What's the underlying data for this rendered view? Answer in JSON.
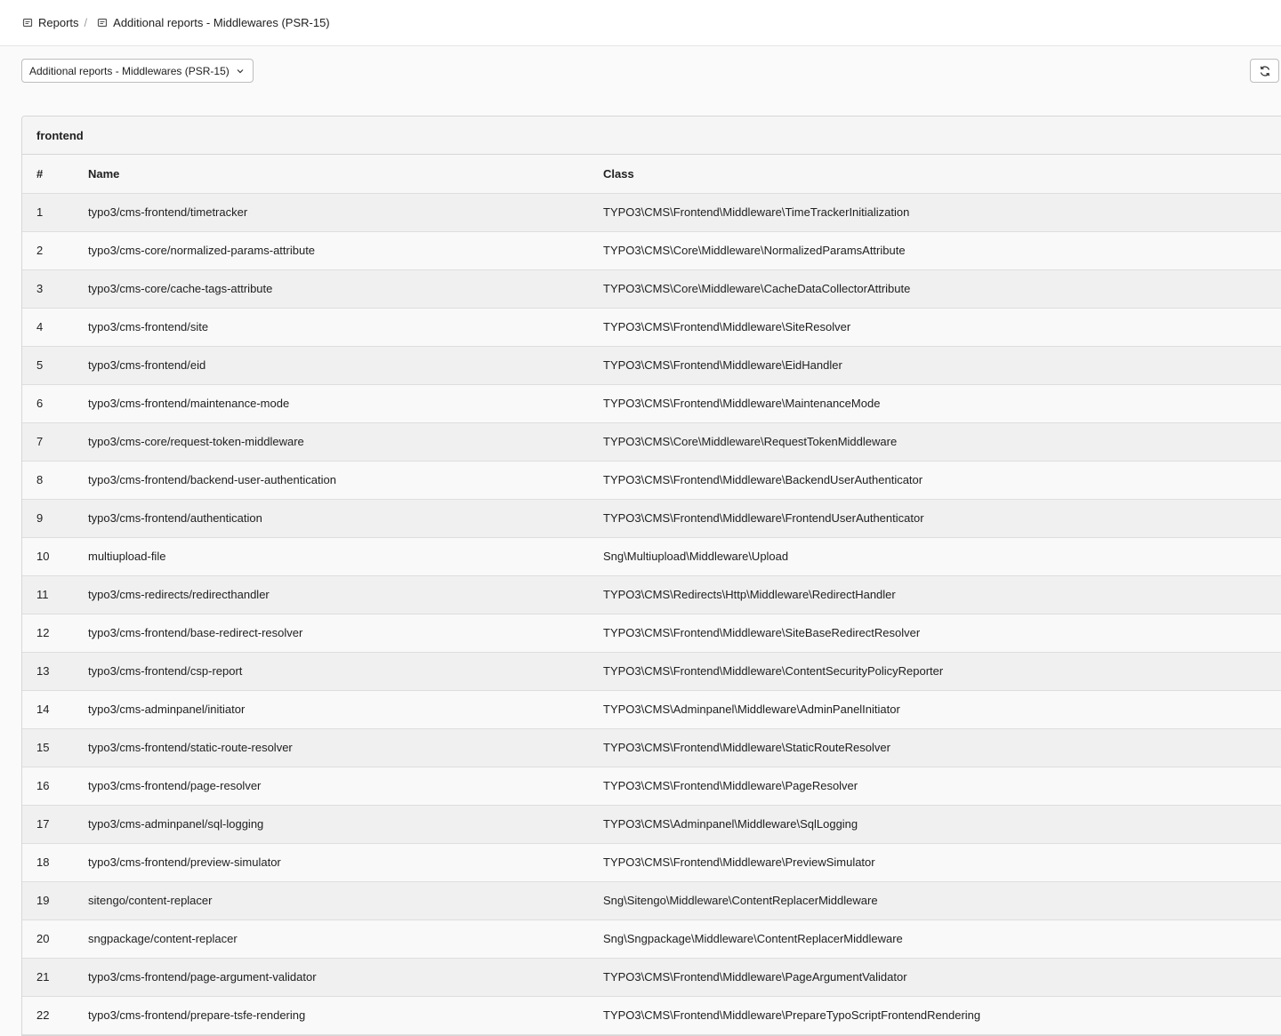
{
  "breadcrumb": {
    "root": "Reports",
    "separator": "/",
    "current": "Additional reports - Middlewares (PSR-15)"
  },
  "toolbar": {
    "report_select_value": "Additional reports - Middlewares (PSR-15)"
  },
  "panel": {
    "title": "frontend",
    "columns": [
      "#",
      "Name",
      "Class"
    ],
    "rows": [
      {
        "n": "1",
        "name": "typo3/cms-frontend/timetracker",
        "cls": "TYPO3\\CMS\\Frontend\\Middleware\\TimeTrackerInitialization"
      },
      {
        "n": "2",
        "name": "typo3/cms-core/normalized-params-attribute",
        "cls": "TYPO3\\CMS\\Core\\Middleware\\NormalizedParamsAttribute"
      },
      {
        "n": "3",
        "name": "typo3/cms-core/cache-tags-attribute",
        "cls": "TYPO3\\CMS\\Core\\Middleware\\CacheDataCollectorAttribute"
      },
      {
        "n": "4",
        "name": "typo3/cms-frontend/site",
        "cls": "TYPO3\\CMS\\Frontend\\Middleware\\SiteResolver"
      },
      {
        "n": "5",
        "name": "typo3/cms-frontend/eid",
        "cls": "TYPO3\\CMS\\Frontend\\Middleware\\EidHandler"
      },
      {
        "n": "6",
        "name": "typo3/cms-frontend/maintenance-mode",
        "cls": "TYPO3\\CMS\\Frontend\\Middleware\\MaintenanceMode"
      },
      {
        "n": "7",
        "name": "typo3/cms-core/request-token-middleware",
        "cls": "TYPO3\\CMS\\Core\\Middleware\\RequestTokenMiddleware"
      },
      {
        "n": "8",
        "name": "typo3/cms-frontend/backend-user-authentication",
        "cls": "TYPO3\\CMS\\Frontend\\Middleware\\BackendUserAuthenticator"
      },
      {
        "n": "9",
        "name": "typo3/cms-frontend/authentication",
        "cls": "TYPO3\\CMS\\Frontend\\Middleware\\FrontendUserAuthenticator"
      },
      {
        "n": "10",
        "name": "multiupload-file",
        "cls": "Sng\\Multiupload\\Middleware\\Upload"
      },
      {
        "n": "11",
        "name": "typo3/cms-redirects/redirecthandler",
        "cls": "TYPO3\\CMS\\Redirects\\Http\\Middleware\\RedirectHandler"
      },
      {
        "n": "12",
        "name": "typo3/cms-frontend/base-redirect-resolver",
        "cls": "TYPO3\\CMS\\Frontend\\Middleware\\SiteBaseRedirectResolver"
      },
      {
        "n": "13",
        "name": "typo3/cms-frontend/csp-report",
        "cls": "TYPO3\\CMS\\Frontend\\Middleware\\ContentSecurityPolicyReporter"
      },
      {
        "n": "14",
        "name": "typo3/cms-adminpanel/initiator",
        "cls": "TYPO3\\CMS\\Adminpanel\\Middleware\\AdminPanelInitiator"
      },
      {
        "n": "15",
        "name": "typo3/cms-frontend/static-route-resolver",
        "cls": "TYPO3\\CMS\\Frontend\\Middleware\\StaticRouteResolver"
      },
      {
        "n": "16",
        "name": "typo3/cms-frontend/page-resolver",
        "cls": "TYPO3\\CMS\\Frontend\\Middleware\\PageResolver"
      },
      {
        "n": "17",
        "name": "typo3/cms-adminpanel/sql-logging",
        "cls": "TYPO3\\CMS\\Adminpanel\\Middleware\\SqlLogging"
      },
      {
        "n": "18",
        "name": "typo3/cms-frontend/preview-simulator",
        "cls": "TYPO3\\CMS\\Frontend\\Middleware\\PreviewSimulator"
      },
      {
        "n": "19",
        "name": "sitengo/content-replacer",
        "cls": "Sng\\Sitengo\\Middleware\\ContentReplacerMiddleware"
      },
      {
        "n": "20",
        "name": "sngpackage/content-replacer",
        "cls": "Sng\\Sngpackage\\Middleware\\ContentReplacerMiddleware"
      },
      {
        "n": "21",
        "name": "typo3/cms-frontend/page-argument-validator",
        "cls": "TYPO3\\CMS\\Frontend\\Middleware\\PageArgumentValidator"
      },
      {
        "n": "22",
        "name": "typo3/cms-frontend/prepare-tsfe-rendering",
        "cls": "TYPO3\\CMS\\Frontend\\Middleware\\PrepareTypoScriptFrontendRendering"
      }
    ]
  }
}
